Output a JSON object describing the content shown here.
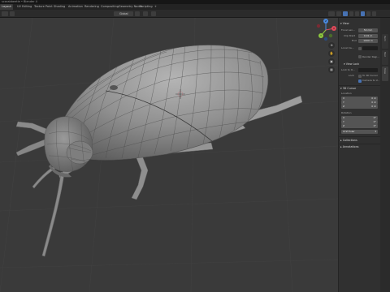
{
  "window": {
    "title": "scarabbeetle • Blender 4"
  },
  "workspaces": {
    "tabs": [
      "Layout",
      "UV Editing",
      "Texture Paint",
      "Shading",
      "Animation",
      "Rendering",
      "Compositing",
      "Geometry Nodes",
      "Scripting",
      "+"
    ],
    "active": "Layout"
  },
  "header": {
    "orientation_label": "Global",
    "options_label": "Options"
  },
  "sidebar_tabs": [
    "Item",
    "Tool",
    "View"
  ],
  "view_panel": {
    "section_title": "View",
    "focal_length_label": "Focal Len...",
    "focal_length_value": "50 mm",
    "clip_start_label": "Clip Start",
    "clip_start_value": "0.01 m",
    "clip_end_label": "End",
    "clip_end_value": "1000 m",
    "local_camera_label": "Local Ca...",
    "render_region_label": "Render Regi...",
    "view_lock_title": "View Lock",
    "lock_to_object_label": "Lock to O...",
    "lock_label": "Lock",
    "to_3d_cursor_label": "To 3D Cursor",
    "camera_to_view_label": "Camera to V..."
  },
  "cursor_panel": {
    "section_title": "3D Cursor",
    "location_title": "Location",
    "location": [
      {
        "axis": "X",
        "value": "0 m"
      },
      {
        "axis": "Y",
        "value": "0 m"
      },
      {
        "axis": "Z",
        "value": "0 m"
      }
    ],
    "rotation_title": "Rotation",
    "rotation": [
      {
        "axis": "X",
        "value": "0°"
      },
      {
        "axis": "Y",
        "value": "0°"
      },
      {
        "axis": "Z",
        "value": "0°"
      }
    ],
    "rotation_mode": "XYZ Euler"
  },
  "collapsed_sections": [
    "Collections",
    "Annotations"
  ],
  "gizmo": {
    "x": "X",
    "y": "Y",
    "z": "Z"
  },
  "colors": {
    "accent": "#4772b3",
    "viewport_bg": "#3a3a3a",
    "panel_bg": "#303030",
    "axis_x": "#e04a5a",
    "axis_y": "#8cc63e",
    "axis_z": "#4a8ae0"
  }
}
